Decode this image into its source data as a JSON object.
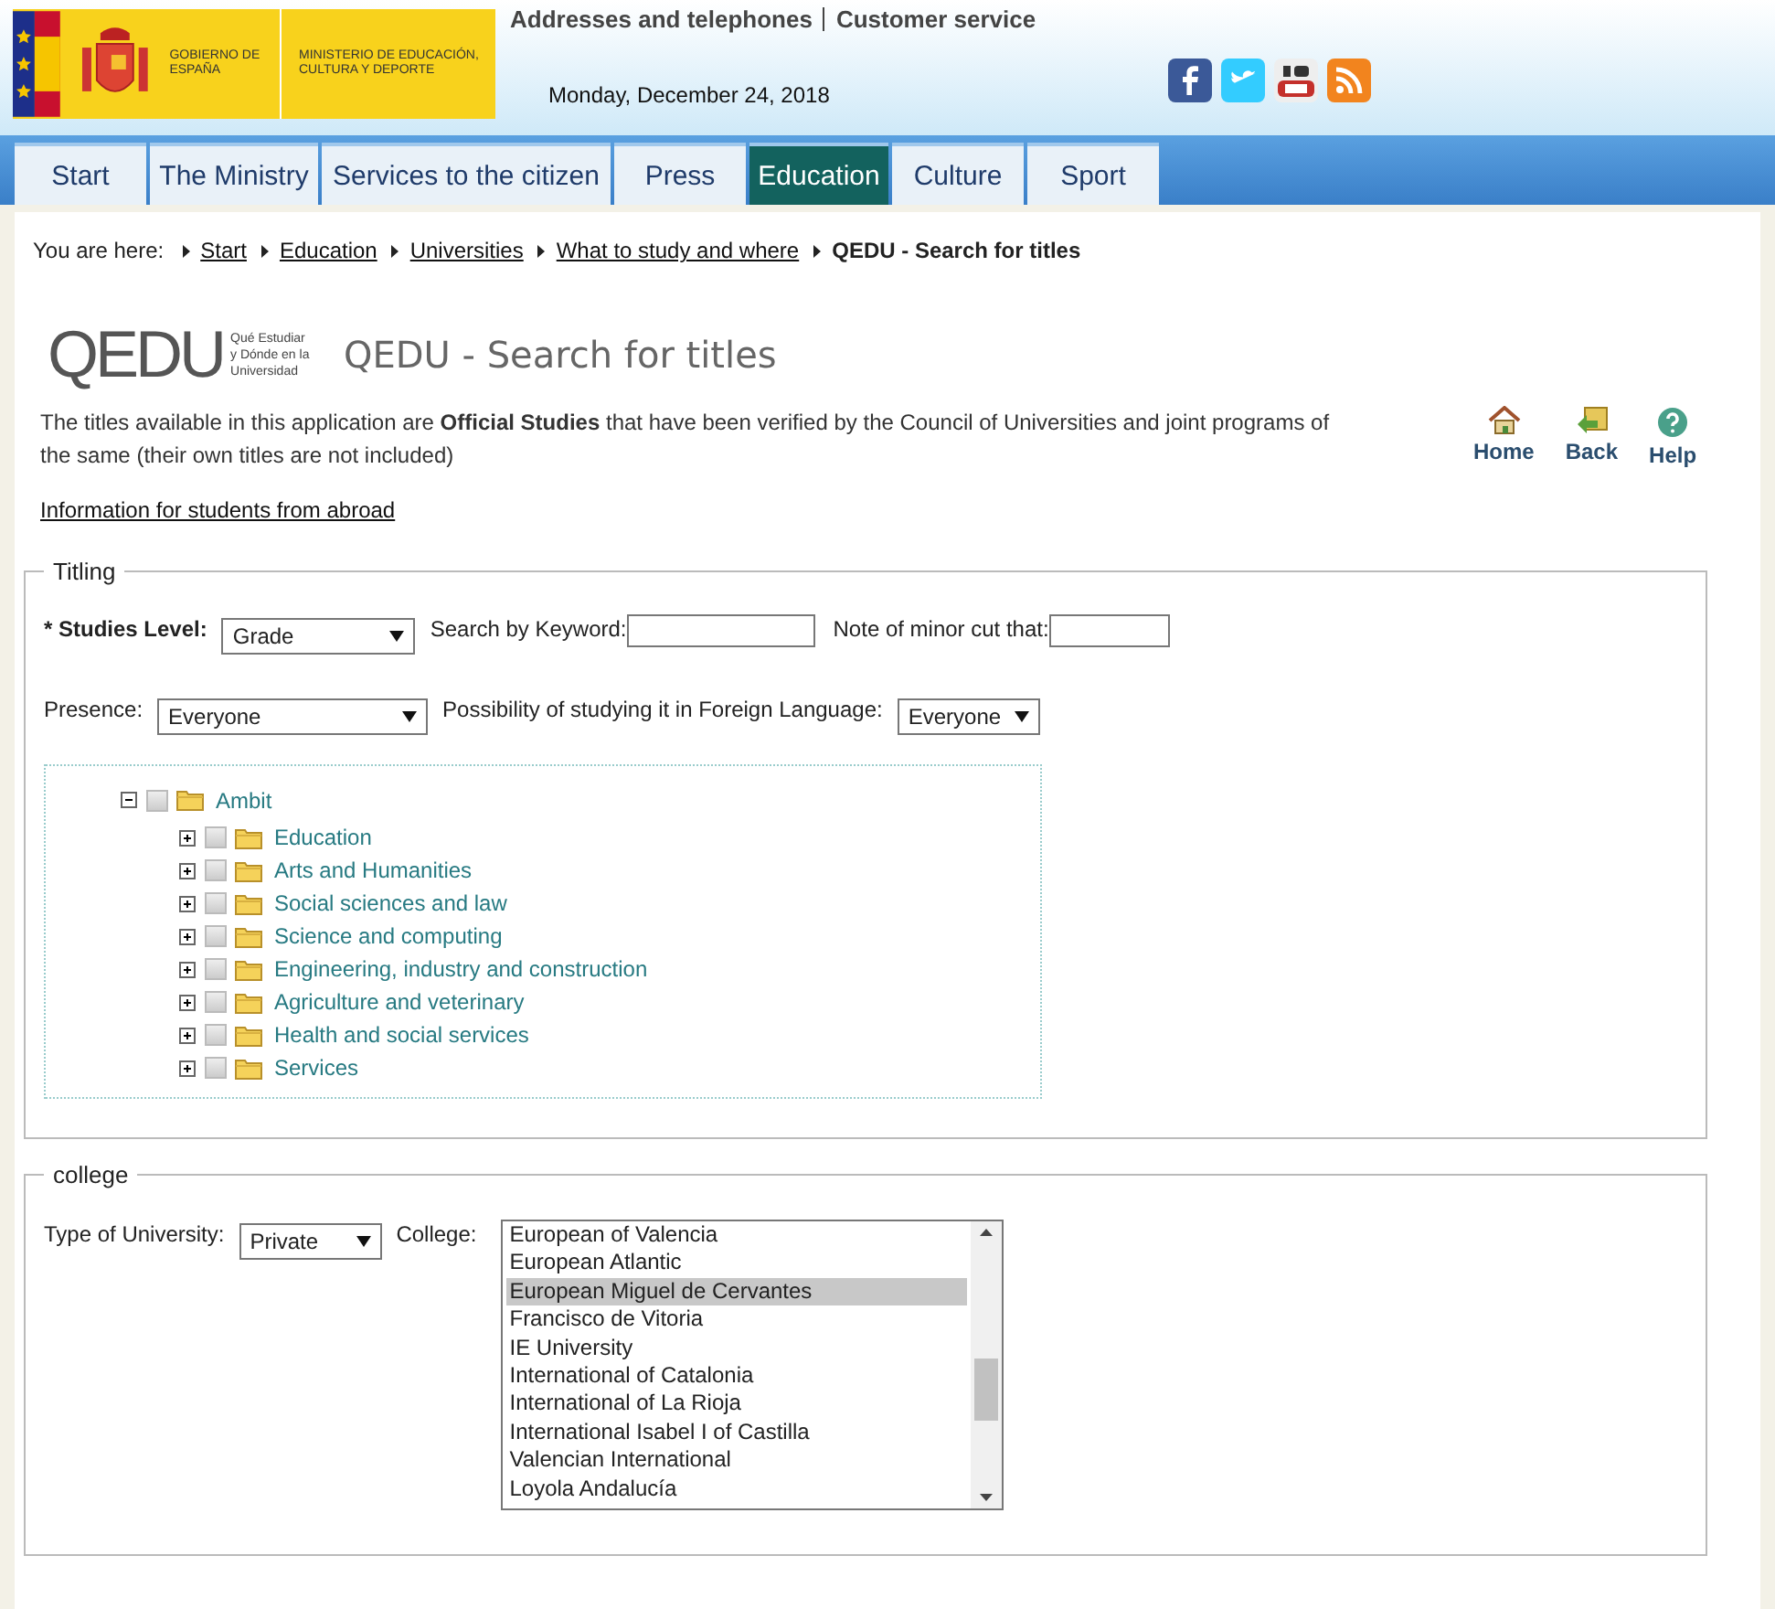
{
  "header": {
    "logo": {
      "government": "GOBIERNO DE ESPAÑA",
      "ministry": "MINISTERIO DE EDUCACIÓN, CULTURA Y DEPORTE"
    },
    "top_links": [
      "Addresses and telephones",
      "Customer service"
    ],
    "date": "Monday, December 24, 2018"
  },
  "nav_tabs": [
    {
      "label": "Start",
      "selected": false
    },
    {
      "label": "The Ministry",
      "selected": false
    },
    {
      "label": "Services to the citizen",
      "selected": false
    },
    {
      "label": "Press",
      "selected": false
    },
    {
      "label": "Education",
      "selected": true
    },
    {
      "label": "Culture",
      "selected": false
    },
    {
      "label": "Sport",
      "selected": false
    }
  ],
  "breadcrumb": {
    "label": "You are here:",
    "links": [
      "Start",
      "Education",
      "Universities",
      "What to study and where"
    ],
    "current": "QEDU - Search for titles"
  },
  "app_logo": {
    "name": "QEDU",
    "tagline": "Qué Estudiar y Dónde en la Universidad"
  },
  "page_title": "QEDU - Search for titles",
  "description": "The titles available in this application are **Official Studies** that have been verified by the Council of Universities and joint programs of the same (their own titles are not included)",
  "tools": [
    "Home",
    "Back",
    "Help"
  ],
  "info_link": "Information for students from abroad",
  "titling": {
    "legend": "Titling",
    "studies_level": {
      "label": "* Studies Level:",
      "value": "Grade"
    },
    "keyword": {
      "label": "Search by Keyword:"
    },
    "minor_cut": {
      "label": "Note of minor cut that:"
    },
    "presence": {
      "label": "Presence:",
      "value": "Everyone"
    },
    "foreign_language": {
      "label": "Possibility of studying it in Foreign Language:",
      "value": "Everyone"
    },
    "tree": [
      {
        "label": "Ambit",
        "expanded": true,
        "checked": false,
        "children": [
          {
            "label": "Education",
            "expanded": false,
            "checked": false
          },
          {
            "label": "Arts and Humanities",
            "expanded": false,
            "checked": false
          },
          {
            "label": "Social sciences and law",
            "expanded": false,
            "checked": false
          },
          {
            "label": "Science and computing",
            "expanded": false,
            "checked": false
          },
          {
            "label": "Engineering, industry and construction",
            "expanded": false,
            "checked": false
          },
          {
            "label": "Agriculture and veterinary",
            "expanded": false,
            "checked": false
          },
          {
            "label": "Health and social services",
            "expanded": false,
            "checked": false
          },
          {
            "label": "Services",
            "expanded": false,
            "checked": false
          }
        ]
      }
    ]
  },
  "college": {
    "legend": "college",
    "university_type": {
      "label": "Type of University:",
      "value": "Private"
    },
    "college_list": {
      "label": "College:",
      "items": [
        {
          "label": "European of Valencia",
          "selected": false
        },
        {
          "label": "European Atlantic",
          "selected": false
        },
        {
          "label": "European Miguel de Cervantes",
          "selected": true
        },
        {
          "label": "Francisco de Vitoria",
          "selected": false
        },
        {
          "label": "IE University",
          "selected": false
        },
        {
          "label": "International of Catalonia",
          "selected": false
        },
        {
          "label": "International of La Rioja",
          "selected": false
        },
        {
          "label": "International Isabel I of Castilla",
          "selected": false
        },
        {
          "label": "Valencian International",
          "selected": false
        },
        {
          "label": "Loyola Andalucía",
          "selected": false
        }
      ]
    }
  }
}
